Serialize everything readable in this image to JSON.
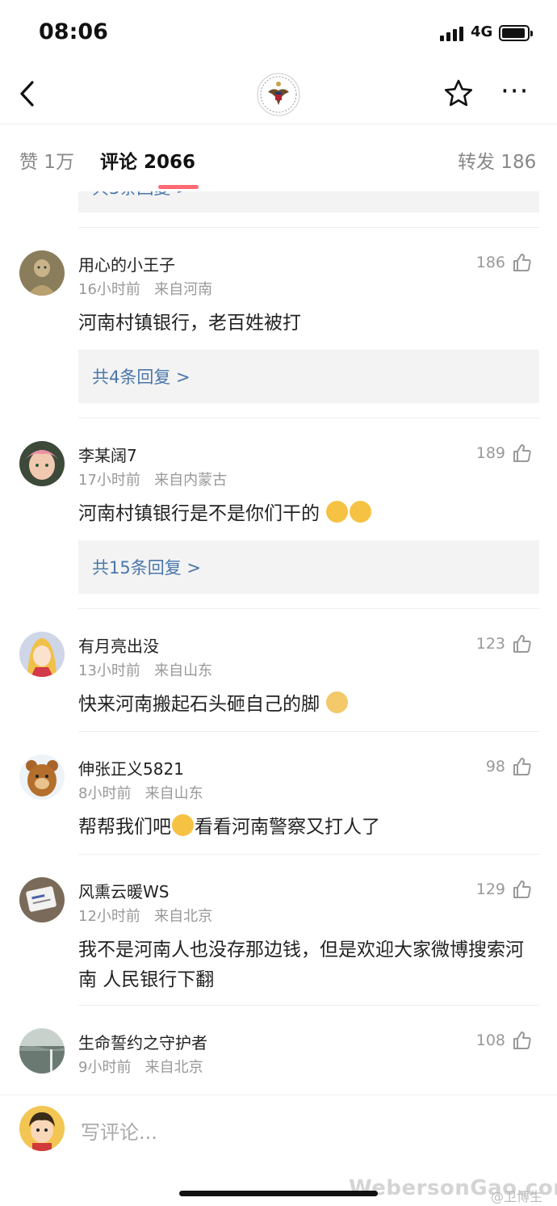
{
  "status_bar": {
    "time": "08:06",
    "network": "4G"
  },
  "header": {
    "back_icon": "chevron-left-icon",
    "avatar_icon": "us-seal-icon",
    "favorite_icon": "star-icon",
    "more_icon": "more-dots-icon",
    "more_glyph": "···"
  },
  "tabs": [
    {
      "label": "赞 1万"
    },
    {
      "label": "评论 2066"
    },
    {
      "label": "转发 186"
    }
  ],
  "colors": {
    "link": "#4a77ab",
    "indicator": "#ff6a72",
    "meta": "#999999",
    "reply_bg": "#f3f3f3"
  },
  "comments": [
    {
      "name": "用心的小王子",
      "time": "16小时前",
      "location": "来自河南",
      "likes": "186",
      "text": "河南村镇银行，老百姓被打",
      "replies": "共4条回复 >"
    },
    {
      "name": "李某阔7",
      "time": "17小时前",
      "location": "来自内蒙古",
      "likes": "189",
      "text": "河南村镇银行是不是你们干的",
      "replies": "共15条回复 >"
    },
    {
      "name": "有月亮出没",
      "time": "13小时前",
      "location": "来自山东",
      "likes": "123",
      "text": "快来河南搬起石头砸自己的脚"
    },
    {
      "name": "伸张正义5821",
      "time": "8小时前",
      "location": "来自山东",
      "likes": "98",
      "text_before": "帮帮我们吧",
      "text_after": "看看河南警察又打人了"
    },
    {
      "name": "风熏云暖WS",
      "time": "12小时前",
      "location": "来自北京",
      "likes": "129",
      "text": "我不是河南人也没存那边钱，但是欢迎大家微博搜索河南 人民银行下翻"
    },
    {
      "name": "生命誓约之守护者",
      "time": "9小时前",
      "location": "来自北京",
      "likes": "108"
    }
  ],
  "bottom_bar": {
    "placeholder": "写评论..."
  },
  "watermark": {
    "site": "WebersonGao.com",
    "handle": "@卫博生"
  }
}
